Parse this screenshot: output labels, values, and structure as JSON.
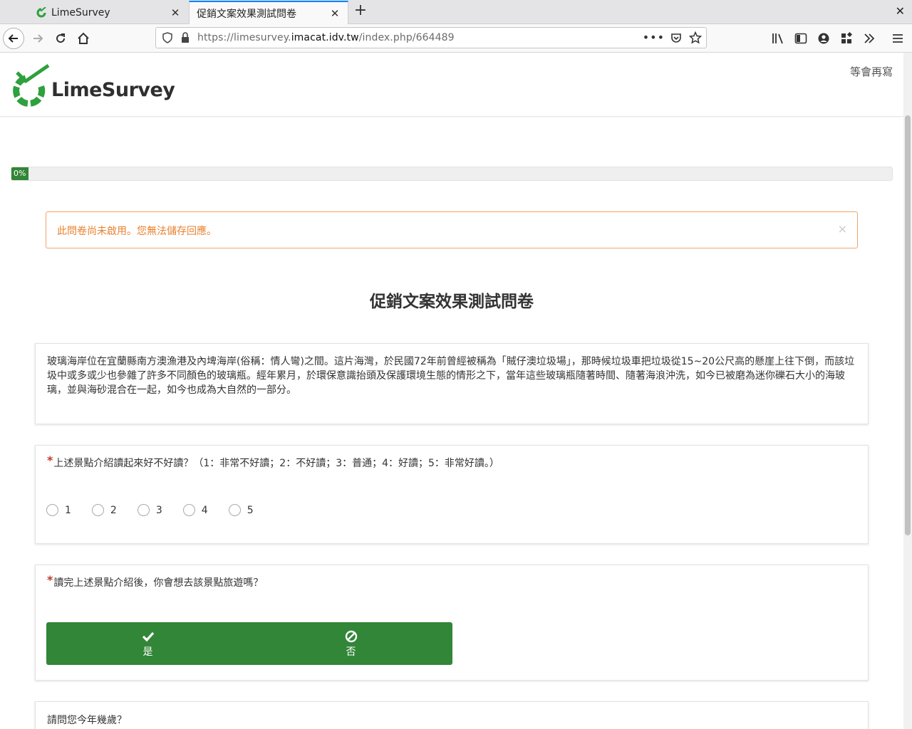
{
  "browser": {
    "tabs": [
      {
        "title": "LimeSurvey",
        "close": "✕"
      },
      {
        "title": "促銷文案效果測試問卷",
        "close": "✕"
      }
    ],
    "new_tab": "+",
    "window_close": "✕",
    "url": {
      "prefix": "https://limesurvey.",
      "host": "imacat.idv.tw",
      "path": "/index.php/664489"
    },
    "url_more": "•••"
  },
  "header": {
    "logo_text": "LimeSurvey",
    "resume_link": "等會再寫"
  },
  "progress": {
    "value": 0,
    "label": "0%"
  },
  "alert": {
    "message": "此問卷尚未啟用。您無法儲存回應。",
    "close": "×"
  },
  "survey": {
    "title": "促銷文案效果測試問卷",
    "description": "玻璃海岸位在宜蘭縣南方澳漁港及內埤海岸(俗稱：情人彎)之間。這片海灣，於民國72年前曾經被稱為「賊仔澳垃圾場」，那時候垃圾車把垃圾從15~20公尺高的懸崖上往下倒，而該垃圾中或多或少也參雜了許多不同顏色的玻璃瓶。經年累月，於環保意識抬頭及保護環境生態的情形之下，當年這些玻璃瓶隨著時間、隨著海浪沖洗，如今已被磨為迷你礫石大小的海玻璃，並與海砂混合在一起，如今也成為大自然的一部分。",
    "q1": {
      "required_mark": "*",
      "text": "上述景點介紹讀起來好不好讀？（1：非常不好讀；2：不好讀；3：普通；4：好讀；5：非常好讀。）",
      "options": [
        "1",
        "2",
        "3",
        "4",
        "5"
      ]
    },
    "q2": {
      "required_mark": "*",
      "text": "讀完上述景點介紹後，你會想去該景點旅遊嗎？",
      "yes": "是",
      "no": "否"
    },
    "q3": {
      "text": "請問您今年幾歲？"
    }
  },
  "colors": {
    "accent_green": "#328637",
    "alert_orange": "#e8812d",
    "tab_highlight": "#0a84ff"
  }
}
